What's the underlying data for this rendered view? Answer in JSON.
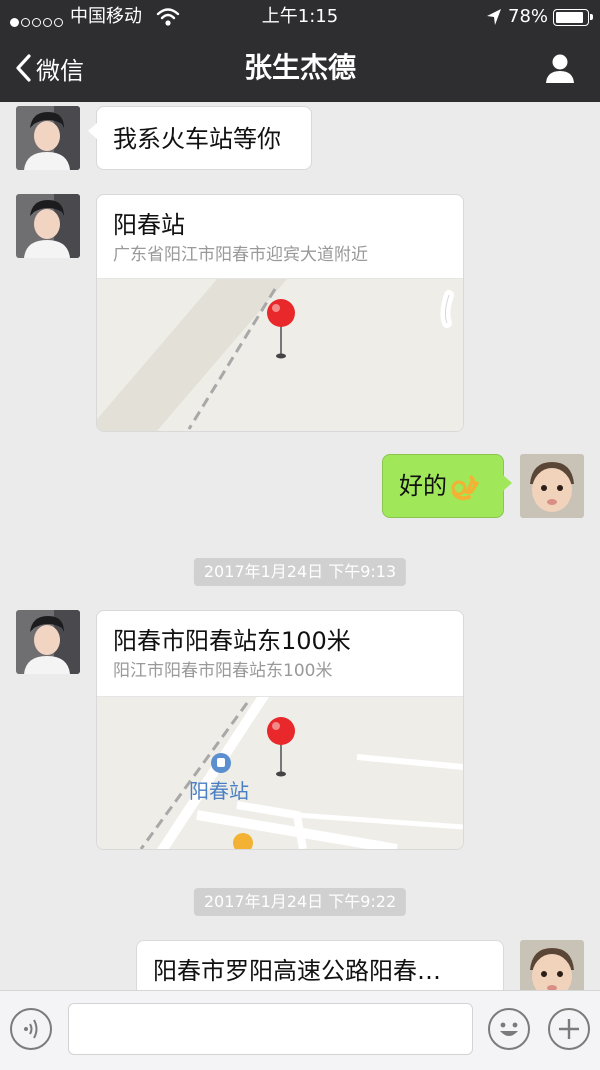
{
  "status_bar": {
    "carrier": "中国移动",
    "time": "上午1:15",
    "battery": "78%",
    "battery_level": 0.78
  },
  "nav": {
    "back_label": "微信",
    "title": "张生杰德",
    "icons": {
      "back": "chevron-left-icon",
      "profile": "person-icon"
    }
  },
  "messages": [
    {
      "type": "text",
      "side": "left",
      "text": "我系火车站等你"
    },
    {
      "type": "location",
      "side": "left",
      "title": "阳春站",
      "address": "广东省阳江市阳春市迎宾大道附近"
    },
    {
      "type": "text",
      "side": "right",
      "text": "好的",
      "emoji": "ok-hand-emoji"
    },
    {
      "type": "time",
      "text": "2017年1月24日 下午9:13"
    },
    {
      "type": "location",
      "side": "left",
      "title": "阳春市阳春站东100米",
      "address": "阳江市阳春市阳春站东100米",
      "map_label": "阳春站"
    },
    {
      "type": "time",
      "text": "2017年1月24日 下午9:22"
    },
    {
      "type": "location",
      "side": "right",
      "title": "阳春市罗阳高速公路阳春…"
    }
  ],
  "input_bar": {
    "placeholder": "",
    "icons": {
      "voice": "voice-icon",
      "emoji": "emoji-icon",
      "more": "plus-icon"
    }
  },
  "colors": {
    "nav_bg": "#2e2e30",
    "chat_bg": "#ebebeb",
    "my_bubble": "#a0e75a",
    "their_bubble": "#ffffff",
    "pin": "#e8282b"
  }
}
